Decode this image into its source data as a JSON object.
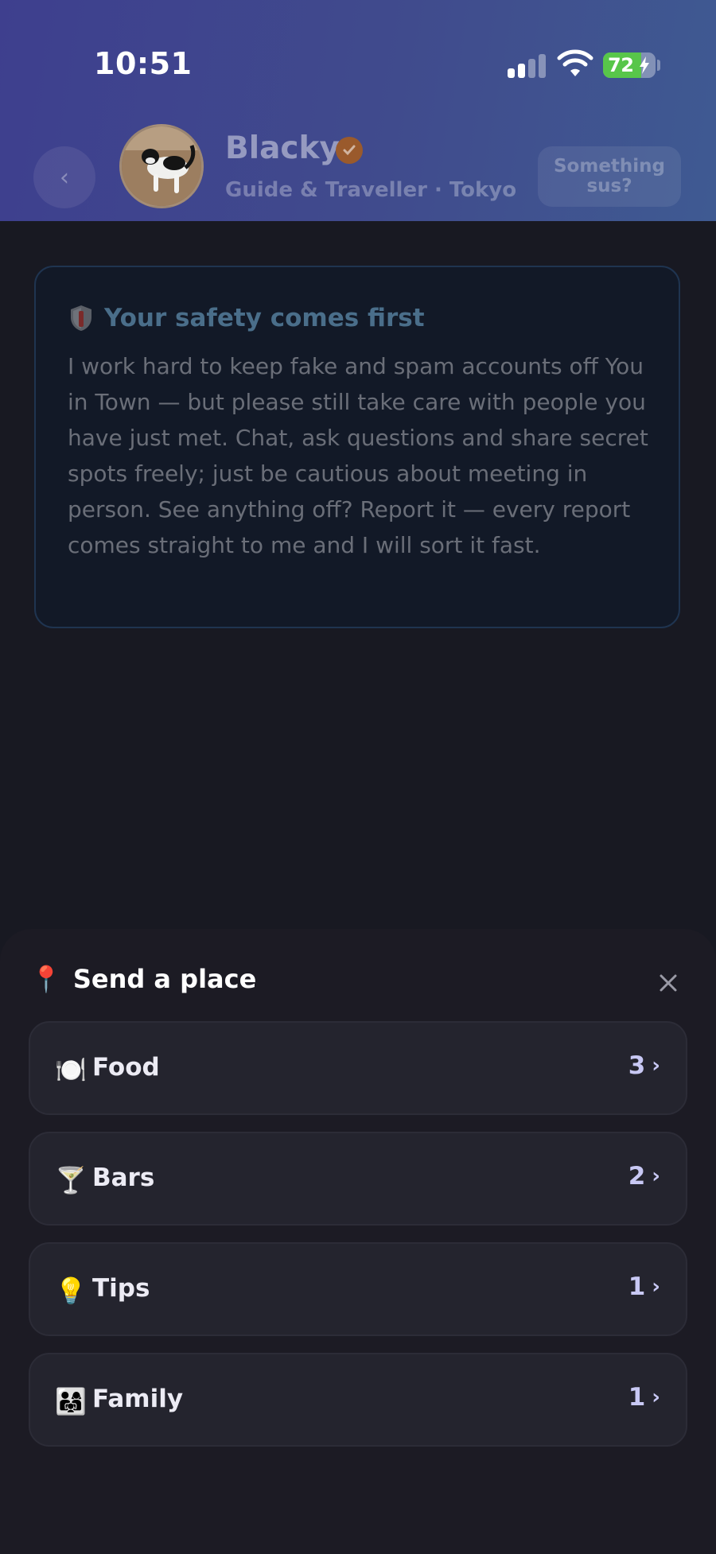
{
  "status_bar": {
    "time": "10:51",
    "battery_text": "72"
  },
  "header": {
    "back_icon": "chevron-left-icon",
    "profile": {
      "name": "Blacky",
      "subtitle": "Guide & Traveller · Tokyo",
      "verified_icon": "verified-check-icon"
    },
    "report_button_label": "Something sus?"
  },
  "safety_card": {
    "icon": "shield-icon",
    "title": "Your safety comes first",
    "body": "I work hard to keep fake and spam accounts off You in Town — but please still take care with people you have just met. Chat, ask questions and share secret spots freely; just be cautious about meeting in person. See anything off? Report it — every report comes straight to me and I will sort it fast."
  },
  "sheet": {
    "icon": "📍",
    "title": "Send a place",
    "close_icon": "close-icon",
    "categories": [
      {
        "icon": "🍽️",
        "label": "Food",
        "count": "3"
      },
      {
        "icon": "🍸",
        "label": "Bars",
        "count": "2"
      },
      {
        "icon": "💡",
        "label": "Tips",
        "count": "1"
      },
      {
        "icon": "👨‍👩‍👧",
        "label": "Family",
        "count": "1"
      }
    ]
  },
  "colors": {
    "header_gradient_start": "#3e3f8e",
    "header_gradient_end": "#3f5a92",
    "background": "#181922",
    "sheet_background": "#1c1b24",
    "row_background": "#24242e",
    "count_color": "#c8c8f4",
    "verified_badge": "#9a5a2c",
    "battery_green": "#58c64a"
  }
}
